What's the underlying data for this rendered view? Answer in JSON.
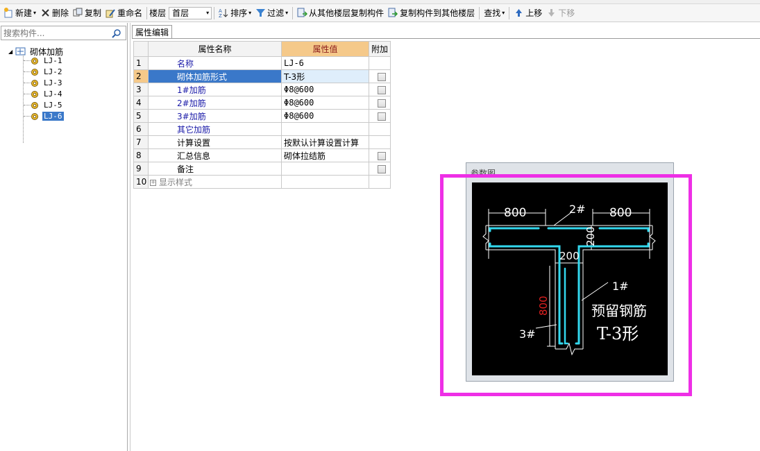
{
  "toolbar": {
    "new_label": "新建",
    "delete_label": "删除",
    "copy_label": "复制",
    "rename_label": "重命名",
    "floor_label": "楼层",
    "floor_value": "首层",
    "sort_label": "排序",
    "filter_label": "过滤",
    "copy_from_label": "从其他楼层复制构件",
    "copy_to_label": "复制构件到其他楼层",
    "find_label": "查找",
    "move_up_label": "上移",
    "move_down_label": "下移"
  },
  "sidebar": {
    "search_placeholder": "搜索构件...",
    "root_label": "砌体加筋",
    "items": [
      {
        "label": "LJ-1"
      },
      {
        "label": "LJ-2"
      },
      {
        "label": "LJ-3"
      },
      {
        "label": "LJ-4"
      },
      {
        "label": "LJ-5"
      },
      {
        "label": "LJ-6"
      }
    ]
  },
  "tab_label": "属性编辑",
  "grid": {
    "headers": {
      "name": "属性名称",
      "value": "属性值",
      "extra": "附加"
    },
    "rows": [
      {
        "num": "1",
        "name": "名称",
        "value": "LJ-6"
      },
      {
        "num": "2",
        "name": "砌体加筋形式",
        "value": "T-3形"
      },
      {
        "num": "3",
        "name": "1#加筋",
        "value": "Φ8@600"
      },
      {
        "num": "4",
        "name": "2#加筋",
        "value": "Φ8@600"
      },
      {
        "num": "5",
        "name": "3#加筋",
        "value": "Φ8@600"
      },
      {
        "num": "6",
        "name": "其它加筋",
        "value": ""
      },
      {
        "num": "7",
        "name": "计算设置",
        "value": "按默认计算设置计算"
      },
      {
        "num": "8",
        "name": "汇总信息",
        "value": "砌体拉结筋"
      },
      {
        "num": "9",
        "name": "备注",
        "value": ""
      },
      {
        "num": "10",
        "name": "显示样式",
        "value": ""
      }
    ]
  },
  "param_panel": {
    "title": "参数图",
    "dim_left": "800",
    "dim_right": "800",
    "dim_flange": "200",
    "dim_web_width": "200",
    "dim_web_length": "800",
    "bar2_label": "2#",
    "bar1_label": "1#",
    "bar3_label": "3#",
    "caption1": "预留钢筋",
    "caption2": "T-3形"
  },
  "colors": {
    "selection": "#3a78c9",
    "header_value": "#f5c98a",
    "rebar": "#33d8ee",
    "highlight": "#ee2fe6",
    "dim_red": "#e02020"
  }
}
